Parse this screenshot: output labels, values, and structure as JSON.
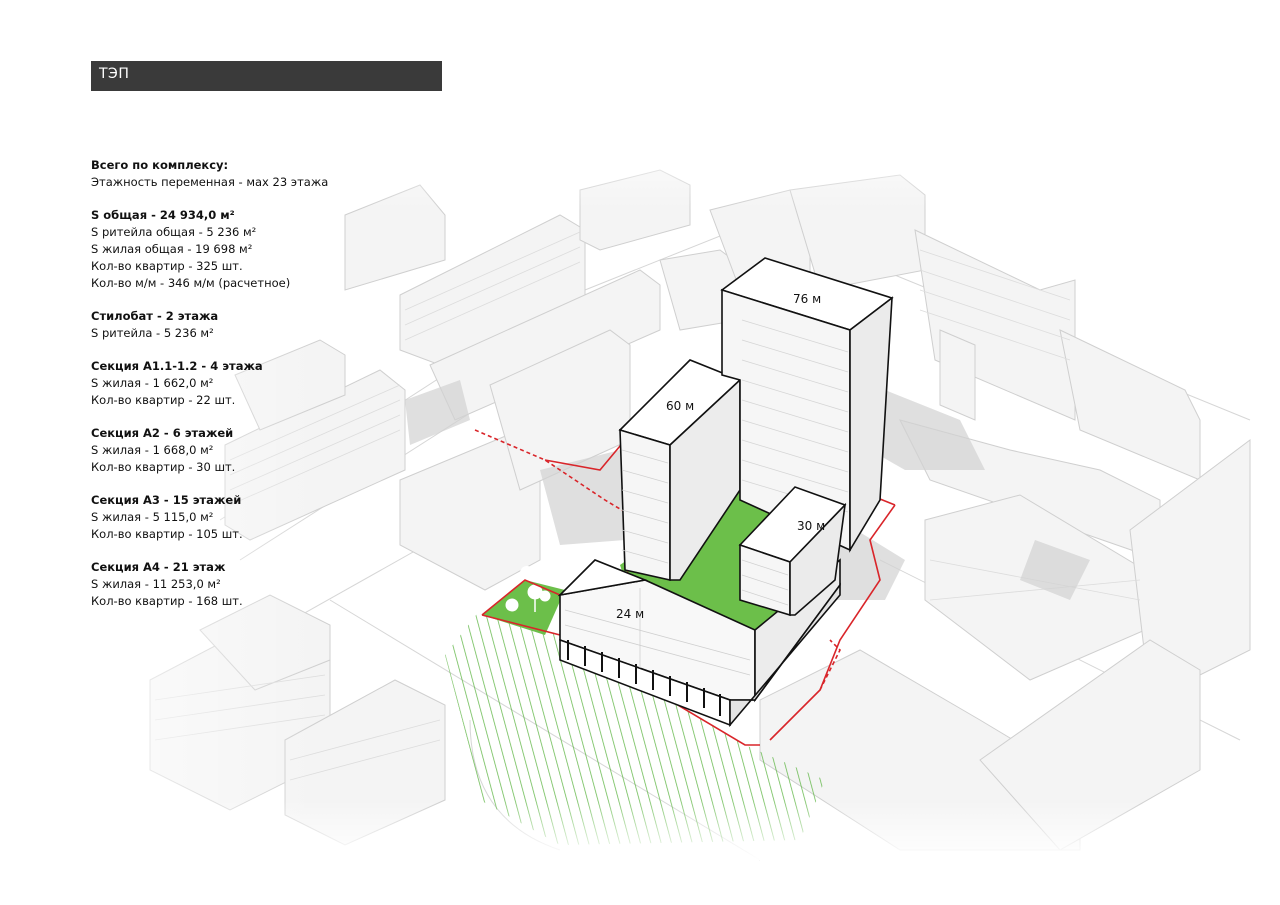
{
  "header": {
    "title": "ТЭП"
  },
  "tep": [
    {
      "heading": "Всего по комплексу:",
      "lines": [
        "Этажность переменная - мах 23 этажа"
      ]
    },
    {
      "heading": "S общая - 24 934,0 м²",
      "lines": [
        "S ритейла общая - 5 236 м²",
        "S жилая общая - 19 698 м²",
        "Кол-во квартир - 325 шт.",
        "Кол-во м/м - 346 м/м (расчетное)"
      ]
    },
    {
      "heading": "Стилобат - 2 этажа",
      "lines": [
        "S ритейла - 5 236 м²"
      ]
    },
    {
      "heading": "Секция А1.1-1.2 - 4 этажа",
      "lines": [
        "S жилая  - 1 662,0 м²",
        "Кол-во квартир - 22 шт."
      ]
    },
    {
      "heading": "Секция А2 - 6 этажей",
      "lines": [
        "S жилая  - 1 668,0 м²",
        "Кол-во квартир - 30 шт."
      ]
    },
    {
      "heading": "Секция А3 - 15 этажей",
      "lines": [
        "S жилая  - 5 115,0 м²",
        "Кол-во квартир - 105 шт."
      ]
    },
    {
      "heading": "Секция А4 - 21 этаж",
      "lines": [
        "S жилая - 11 253,0 м²",
        "Кол-во квартир - 168 шт."
      ]
    }
  ],
  "heights": {
    "tower_76": "76 м",
    "tower_60": "60 м",
    "tower_30": "30 м",
    "block_24": "24 м"
  },
  "colors": {
    "header_bg": "#3a3a3a",
    "green": "#6cbf4a",
    "boundary": "#d9252a",
    "context": "#f2f2f2"
  }
}
